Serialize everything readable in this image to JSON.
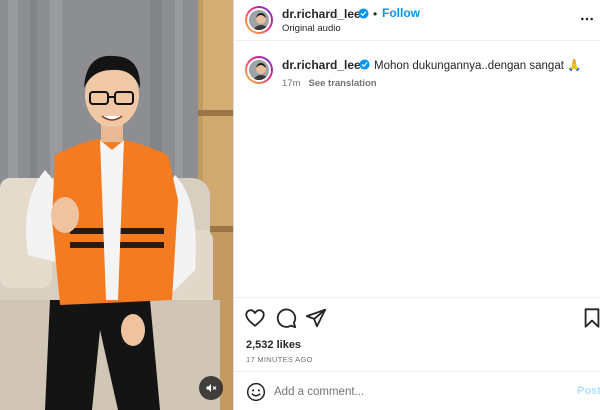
{
  "post": {
    "username": "dr.richard_lee",
    "follow_label": "Follow",
    "separator": "•",
    "audio_label": "Original audio",
    "caption": "Mohon dukungannya..dengan sangat 🙏",
    "age": "17m",
    "see_translation": "See translation",
    "likes": "2,532 likes",
    "time_ago": "17 MINUTES AGO"
  },
  "comment": {
    "placeholder": "Add a comment...",
    "post_label": "Post"
  },
  "colors": {
    "accent": "#0095f6",
    "vest": "#f47b20",
    "text": "#262626",
    "muted": "#737373"
  },
  "icons": [
    "verified-badge-icon",
    "more-options-icon",
    "heart-icon",
    "comment-icon",
    "share-icon",
    "bookmark-icon",
    "emoji-icon",
    "muted-speaker-icon"
  ]
}
